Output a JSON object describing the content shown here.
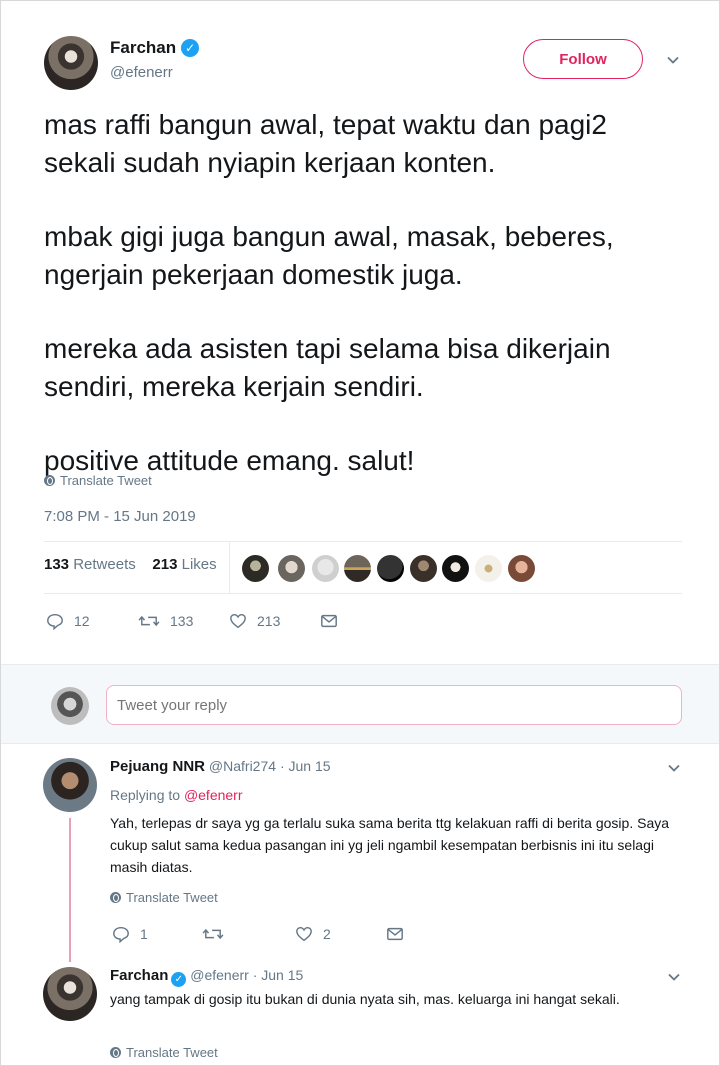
{
  "tweet": {
    "author_name": "Farchan",
    "author_handle": "@efenerr",
    "follow_label": "Follow",
    "paragraphs": [
      "mas raffi bangun awal, tepat waktu dan pagi2 sekali sudah nyiapin kerjaan konten.",
      "mbak gigi juga bangun awal, masak, beberes, ngerjain pekerjaan domestik juga.",
      "mereka ada asisten tapi selama bisa dikerjain sendiri, mereka kerjain sendiri.",
      "positive attitude emang. salut!"
    ],
    "translate_label": "Translate Tweet",
    "timestamp": "7:08 PM - 15 Jun 2019",
    "retweets_count": "133",
    "retweets_label": "Retweets",
    "likes_count": "213",
    "likes_label": "Likes",
    "actions": {
      "replies": "12",
      "retweets": "133",
      "likes": "213"
    }
  },
  "reply_box": {
    "placeholder": "Tweet your reply"
  },
  "replies": [
    {
      "name": "Pejuang NNR",
      "handle": "@Nafri274",
      "date": "· Jun 15",
      "replying_prefix": "Replying to",
      "replying_to": "@efenerr",
      "text": "Yah, terlepas dr saya yg ga terlalu suka sama berita ttg kelakuan raffi di berita gosip. Saya cukup salut sama kedua pasangan ini yg jeli ngambil kesempatan berbisnis ini itu selagi masih diatas.",
      "translate_label": "Translate Tweet",
      "actions": {
        "replies": "1",
        "retweets": "",
        "likes": "2"
      }
    },
    {
      "name": "Farchan",
      "handle": "@efenerr",
      "date": "· Jun 15",
      "text": "yang tampak di gosip itu bukan di dunia nyata sih, mas. keluarga ini hangat sekali.",
      "translate_label": "Translate Tweet"
    }
  ],
  "colors": {
    "accent": "#e0245e",
    "verified": "#1da1f2",
    "muted": "#657786",
    "text": "#14171a"
  }
}
